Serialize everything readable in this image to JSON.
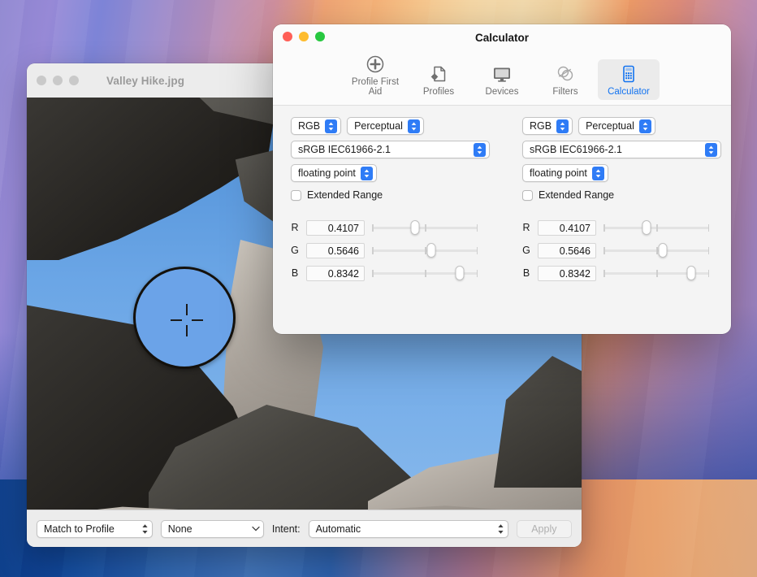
{
  "desktop": {
    "name": "macos-desktop-wallpaper"
  },
  "image_window": {
    "title": "Valley Hike.jpg",
    "traffic_lights": [
      "close",
      "minimize",
      "zoom"
    ],
    "photo_alt": "rock-formation-against-blue-sky",
    "loupe": {
      "name": "color-picker-loupe",
      "sampled_color": "#6BA3E8"
    },
    "bottom_bar": {
      "match_mode": "Match to Profile",
      "profile": "None",
      "intent_label": "Intent:",
      "intent": "Automatic",
      "apply_label": "Apply",
      "apply_enabled": false
    }
  },
  "calculator_window": {
    "title": "Calculator",
    "traffic_lights": [
      "close",
      "minimize",
      "zoom"
    ],
    "toolbar": {
      "items": [
        {
          "label": "Profile First Aid",
          "icon": "plus-circle-icon",
          "active": false
        },
        {
          "label": "Profiles",
          "icon": "document-gear-icon",
          "active": false
        },
        {
          "label": "Devices",
          "icon": "display-icon",
          "active": false
        },
        {
          "label": "Filters",
          "icon": "venn-circles-icon",
          "active": false
        },
        {
          "label": "Calculator",
          "icon": "calculator-icon",
          "active": true
        }
      ]
    },
    "accent_color": "#1273F0",
    "left_panel": {
      "color_space": "RGB",
      "intent": "Perceptual",
      "profile": "sRGB IEC61966-2.1",
      "data_type": "floating point",
      "extended_range_label": "Extended Range",
      "extended_range_checked": false,
      "channels": [
        {
          "label": "R",
          "value": "0.4107",
          "fraction": 0.4107
        },
        {
          "label": "G",
          "value": "0.5646",
          "fraction": 0.5646
        },
        {
          "label": "B",
          "value": "0.8342",
          "fraction": 0.8342
        }
      ],
      "swatch_color": "#6BA3E8"
    },
    "right_panel": {
      "color_space": "RGB",
      "intent": "Perceptual",
      "profile": "sRGB IEC61966-2.1",
      "data_type": "floating point",
      "extended_range_label": "Extended Range",
      "extended_range_checked": false,
      "channels": [
        {
          "label": "R",
          "value": "0.4107",
          "fraction": 0.4107
        },
        {
          "label": "G",
          "value": "0.5646",
          "fraction": 0.5646
        },
        {
          "label": "B",
          "value": "0.8342",
          "fraction": 0.8342
        }
      ],
      "swatch_color": "#6BA3E8"
    },
    "transfer_direction": "left-arrow",
    "magnifier": "magnifier-icon"
  }
}
